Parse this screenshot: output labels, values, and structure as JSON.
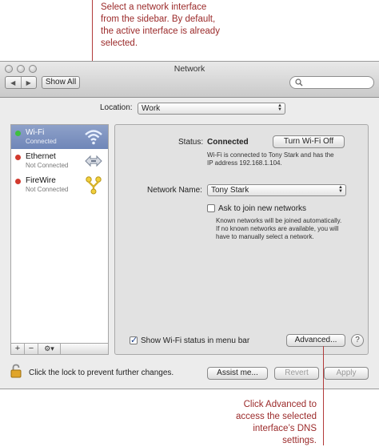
{
  "callouts": {
    "top": [
      "Select a network interface",
      "from the sidebar. By default,",
      "the active interface is already",
      "selected."
    ],
    "bottom": [
      "Click Advanced to",
      "access the selected",
      "interface’s DNS",
      "settings."
    ]
  },
  "window": {
    "title": "Network"
  },
  "toolbar": {
    "back_icon": "back-arrow-icon",
    "forward_icon": "forward-arrow-icon",
    "show_all_label": "Show All",
    "search_placeholder": ""
  },
  "location": {
    "label": "Location:",
    "value": "Work"
  },
  "services": [
    {
      "name": "Wi-Fi",
      "status": "Connected",
      "status_color": "#3fbf3f",
      "icon": "wifi-icon",
      "selected": true
    },
    {
      "name": "Ethernet",
      "status": "Not Connected",
      "status_color": "#d23a2e",
      "icon": "ethernet-icon",
      "selected": false
    },
    {
      "name": "FireWire",
      "status": "Not Connected",
      "status_color": "#d23a2e",
      "icon": "firewire-icon",
      "selected": false
    }
  ],
  "sidebar_footer": {
    "add": "+",
    "remove": "−",
    "gear": "⚙▾"
  },
  "detail": {
    "status_label": "Status:",
    "status_value": "Connected",
    "turn_off_label": "Turn Wi-Fi Off",
    "status_desc": [
      "Wi-Fi is connected to Tony Stark and has the",
      "IP address 192.168.1.104."
    ],
    "network_name_label": "Network Name:",
    "network_name_value": "Tony Stark",
    "ask_join_label": "Ask to join new networks",
    "ask_join_checked": false,
    "ask_join_desc": [
      "Known networks will be joined automatically.",
      "If no known networks are available, you will",
      "have to manually select a network."
    ],
    "show_status_label": "Show Wi-Fi status in menu bar",
    "show_status_checked": true,
    "advanced_label": "Advanced...",
    "help_label": "?"
  },
  "bottom_bar": {
    "lock_text": "Click the lock to prevent further changes.",
    "assist_label": "Assist me...",
    "revert_label": "Revert",
    "apply_label": "Apply"
  },
  "colors": {
    "selection": "#7b8fbf",
    "callout": "#9b2a2a"
  }
}
